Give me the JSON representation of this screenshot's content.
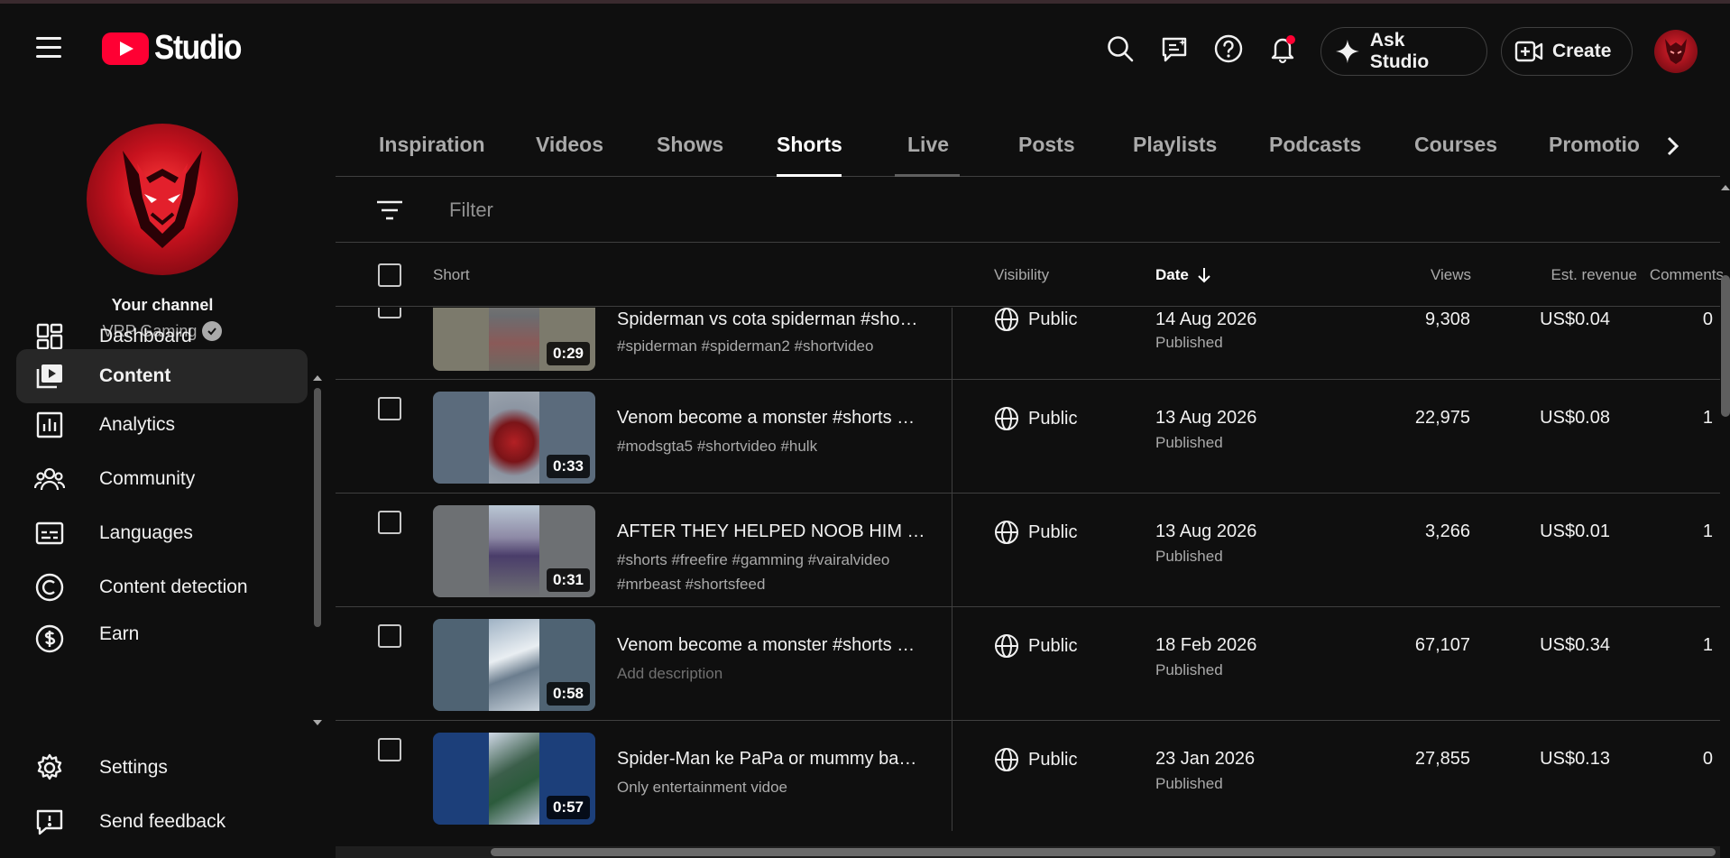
{
  "app": {
    "logo_text": "Studio",
    "brand_color": "#ff0033"
  },
  "header": {
    "icons": [
      "search-icon",
      "feedback-icon",
      "help-icon",
      "notifications-icon"
    ],
    "ask_studio_label": "Ask Studio",
    "create_label": "Create"
  },
  "sidebar": {
    "channel_title": "Your channel",
    "channel_name": "VRP Gaming",
    "items": [
      {
        "label": "Dashboard",
        "icon": "dashboard-icon"
      },
      {
        "label": "Content",
        "icon": "content-icon",
        "active": true
      },
      {
        "label": "Analytics",
        "icon": "analytics-icon"
      },
      {
        "label": "Community",
        "icon": "community-icon"
      },
      {
        "label": "Languages",
        "icon": "languages-icon"
      },
      {
        "label": "Content detection",
        "icon": "copyright-icon"
      },
      {
        "label": "Earn",
        "icon": "earn-icon"
      }
    ],
    "footer": [
      {
        "label": "Settings",
        "icon": "gear-icon"
      },
      {
        "label": "Send feedback",
        "icon": "feedback-icon"
      }
    ]
  },
  "tabs": [
    "Inspiration",
    "Videos",
    "Shows",
    "Shorts",
    "Live",
    "Posts",
    "Playlists",
    "Podcasts",
    "Courses",
    "Promotio"
  ],
  "active_tab": "Shorts",
  "filter": {
    "placeholder": "Filter"
  },
  "table": {
    "headers": {
      "short": "Short",
      "visibility": "Visibility",
      "date": "Date",
      "views": "Views",
      "revenue": "Est. revenue",
      "comments": "Comments"
    },
    "rows": [
      {
        "title": "Spiderman vs cota spiderman #sho…",
        "description": "#spiderman #spiderman2 #shortvideo",
        "duration": "0:29",
        "visibility": "Public",
        "date": "14 Aug 2026",
        "status": "Published",
        "views": "9,308",
        "revenue": "US$0.04",
        "comments": "0"
      },
      {
        "title": "Venom become a monster #shorts …",
        "description": "#modsgta5 #shortvideo #hulk",
        "duration": "0:33",
        "visibility": "Public",
        "date": "13 Aug 2026",
        "status": "Published",
        "views": "22,975",
        "revenue": "US$0.08",
        "comments": "1"
      },
      {
        "title": "AFTER THEY HELPED NOOB HIM H…",
        "description": "#shorts #freefire #gamming #vairalvideo #mrbeast #shortsfeed",
        "duration": "0:31",
        "visibility": "Public",
        "date": "13 Aug 2026",
        "status": "Published",
        "views": "3,266",
        "revenue": "US$0.01",
        "comments": "1"
      },
      {
        "title": "Venom become a monster #shorts …",
        "description": "Add description",
        "duration": "0:58",
        "visibility": "Public",
        "date": "18 Feb 2026",
        "status": "Published",
        "views": "67,107",
        "revenue": "US$0.34",
        "comments": "1"
      },
      {
        "title": "Spider-Man ke PaPa or mummy ba…",
        "description": "Only entertainment vidoe",
        "duration": "0:57",
        "visibility": "Public",
        "date": "23 Jan 2026",
        "status": "Published",
        "views": "27,855",
        "revenue": "US$0.13",
        "comments": "0"
      }
    ]
  }
}
